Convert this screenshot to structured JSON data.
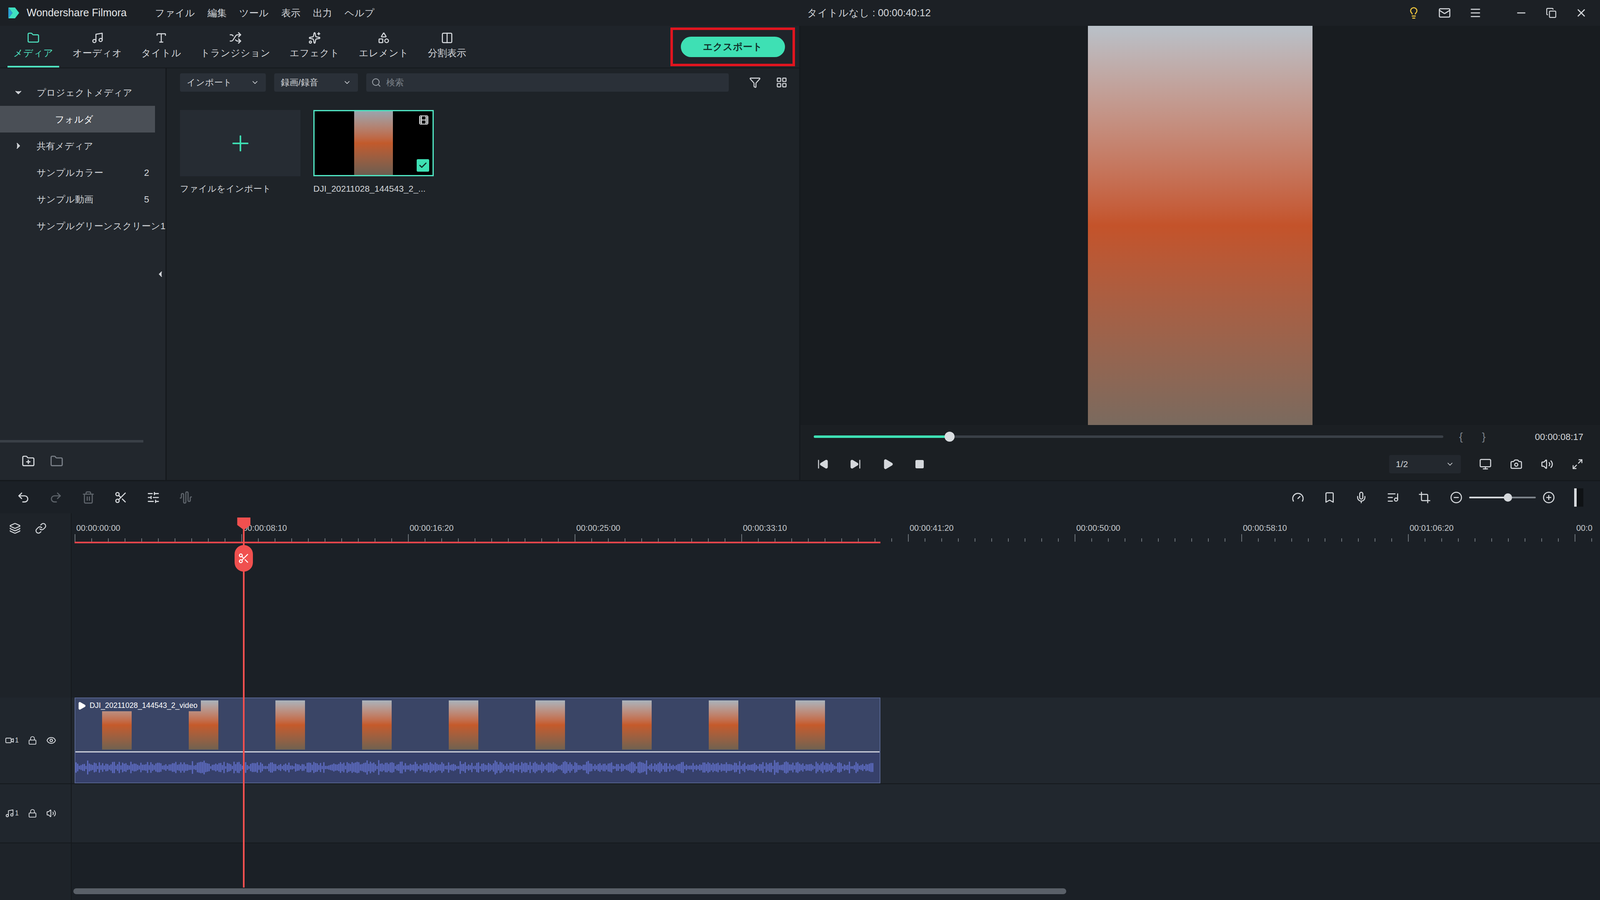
{
  "window": {
    "app_name": "Wondershare Filmora",
    "title": "タイトルなし : 00:00:40:12"
  },
  "menu": [
    "ファイル",
    "編集",
    "ツール",
    "表示",
    "出力",
    "ヘルプ"
  ],
  "tabs": [
    {
      "label": "メディア",
      "selected": true
    },
    {
      "label": "オーディオ",
      "selected": false
    },
    {
      "label": "タイトル",
      "selected": false
    },
    {
      "label": "トランジション",
      "selected": false
    },
    {
      "label": "エフェクト",
      "selected": false
    },
    {
      "label": "エレメント",
      "selected": false
    },
    {
      "label": "分割表示",
      "selected": false
    }
  ],
  "export_button": {
    "label": "エクスポート",
    "highlighted": true
  },
  "sidebar": {
    "items": [
      {
        "label": "プロジェクトメディア",
        "count": "",
        "kind": "group",
        "expanded": true,
        "selected": false
      },
      {
        "label": "フォルダ",
        "count": "",
        "kind": "folder",
        "expanded": false,
        "selected": true
      },
      {
        "label": "共有メディア",
        "count": "",
        "kind": "group",
        "expanded": false,
        "selected": false
      },
      {
        "label": "サンプルカラー",
        "count": "2",
        "kind": "item",
        "expanded": false,
        "selected": false
      },
      {
        "label": "サンプル動画",
        "count": "5",
        "kind": "item",
        "expanded": false,
        "selected": false
      },
      {
        "label": "サンプルグリーンスクリーン",
        "count": "1",
        "kind": "item",
        "expanded": false,
        "selected": false
      }
    ]
  },
  "media_toolbar": {
    "import_label": "インポート",
    "record_label": "録画/録音",
    "search_placeholder": "検索"
  },
  "media_items": [
    {
      "kind": "import",
      "label": "ファイルをインポート",
      "selected": false
    },
    {
      "kind": "clip",
      "label": "DJI_20211028_144543_2_...",
      "selected": true
    }
  ],
  "preview": {
    "level": 0.216,
    "brace_open": "{",
    "brace_close": "}",
    "time": "00:00:08:17",
    "quality": "1/2"
  },
  "timeline": {
    "tools": [
      {
        "disabled": false
      },
      {
        "disabled": true
      },
      {
        "disabled": true
      },
      {
        "disabled": false
      },
      {
        "disabled": false
      },
      {
        "disabled": true
      }
    ],
    "zoom_level": 0.58,
    "ruler": [
      "00:00:00:00",
      "00:00:08:10",
      "00:00:16:20",
      "00:00:25:00",
      "00:00:33:10",
      "00:00:41:20",
      "00:00:50:00",
      "00:00:58:10",
      "00:01:06:20",
      "00:0"
    ],
    "playhead_level": 0.111,
    "tracks": [
      {
        "kind": "video",
        "number": "1",
        "clip": "DJI_20211028_144543_2_video"
      },
      {
        "kind": "audio",
        "number": "1",
        "clip": ""
      }
    ]
  }
}
